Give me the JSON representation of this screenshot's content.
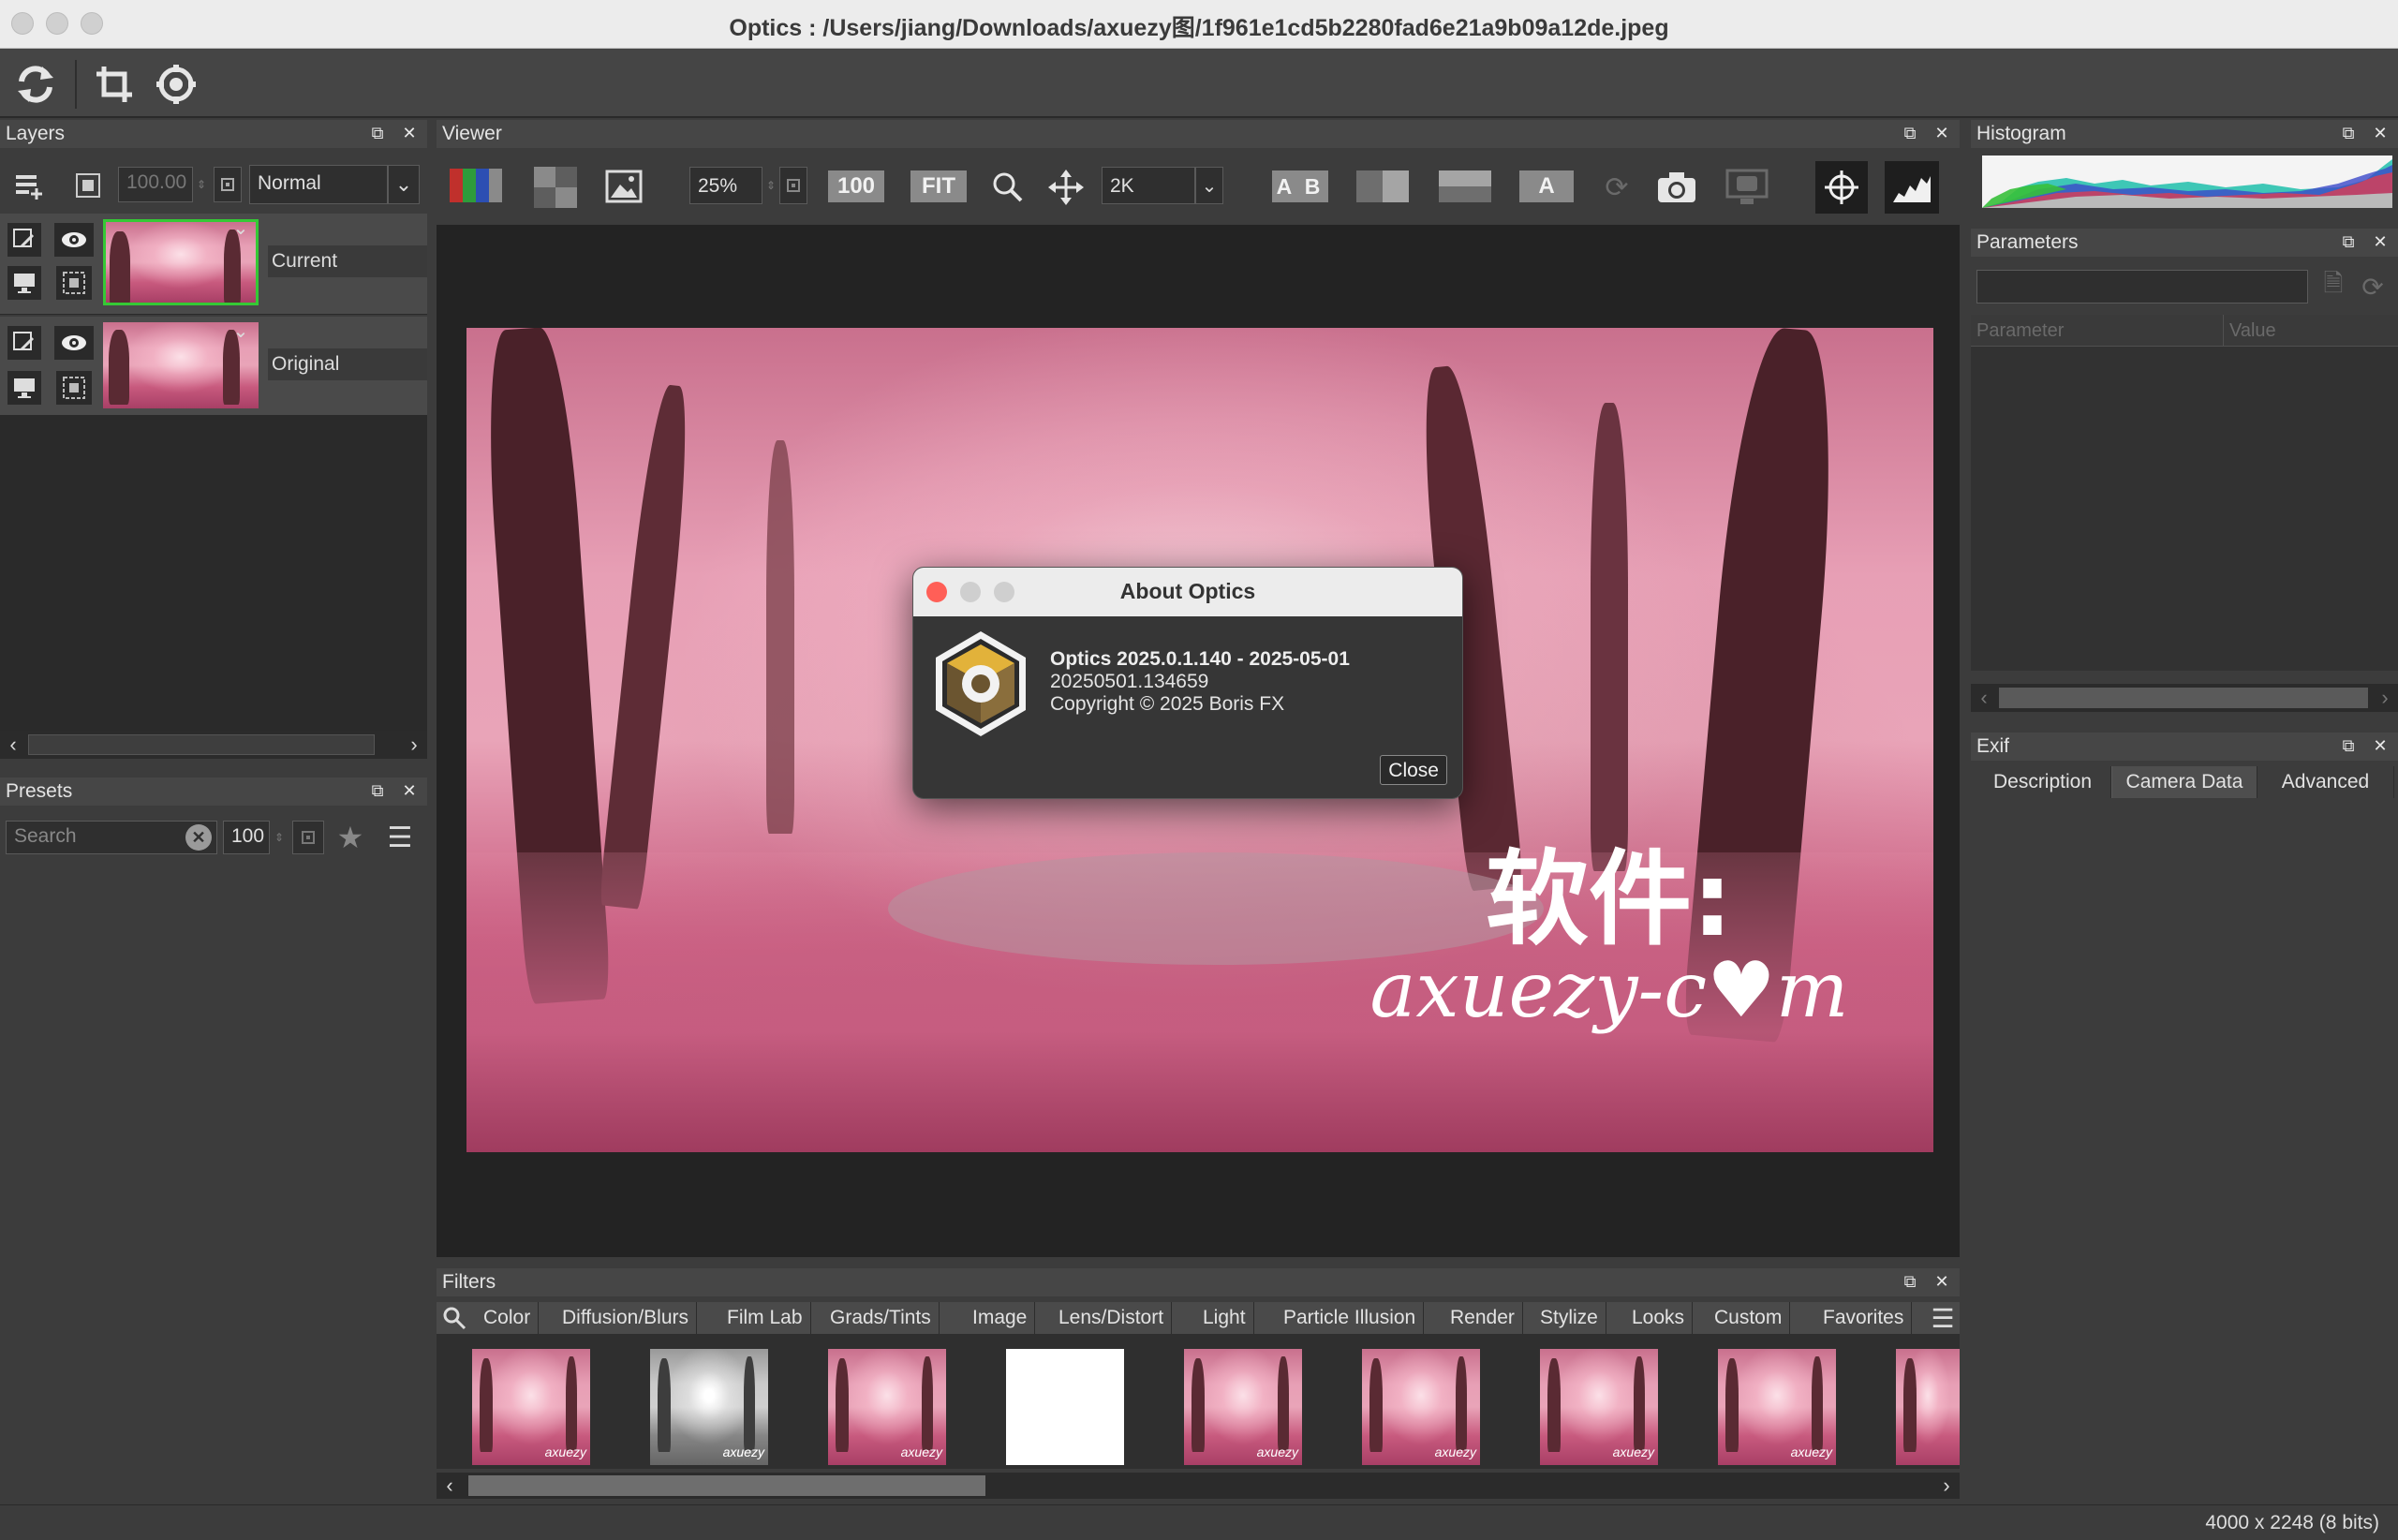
{
  "window": {
    "title": "Optics : /Users/jiang/Downloads/axuezy图/1f961e1cd5b2280fad6e21a9b09a12de.jpeg"
  },
  "toolbar": {
    "icons": [
      "refresh-icon",
      "crop-icon",
      "focus-icon"
    ]
  },
  "layers": {
    "title": "Layers",
    "opacity_value": "100.00",
    "blend_mode": "Normal",
    "items": [
      {
        "label": "Current",
        "selected": true
      },
      {
        "label": "Original",
        "selected": false
      }
    ]
  },
  "presets": {
    "title": "Presets",
    "search_placeholder": "Search",
    "size_value": "100"
  },
  "viewer": {
    "title": "Viewer",
    "zoom": "25%",
    "zoom_100": "100",
    "fit": "FIT",
    "resolution": "2K",
    "ab_label": "A B",
    "text_overlay": "A",
    "watermark_line1": "软件:",
    "watermark_line2": "axuezy-c♥m"
  },
  "about_dialog": {
    "title": "About Optics",
    "version_line": "Optics 2025.0.1.140 - 2025-05-01",
    "build_line": "20250501.134659",
    "copyright_line": "Copyright © 2025 Boris FX",
    "close_label": "Close"
  },
  "histogram": {
    "title": "Histogram"
  },
  "parameters": {
    "title": "Parameters",
    "col_parameter": "Parameter",
    "col_value": "Value"
  },
  "exif": {
    "title": "Exif",
    "tabs": [
      "Description",
      "Camera Data",
      "Advanced"
    ],
    "active_tab": "Camera Data"
  },
  "filters": {
    "title": "Filters",
    "tabs": [
      "Color",
      "Diffusion/Blurs",
      "Film Lab",
      "Grads/Tints",
      "Image",
      "Lens/Distort",
      "Light",
      "Particle Illusion",
      "Render",
      "Stylize",
      "Looks",
      "Custom",
      "Favorites"
    ],
    "thumb_label": "axuezy"
  },
  "status": {
    "image_info": "4000 x 2248 (8 bits)"
  },
  "colors": {
    "selection_border": "#35c935",
    "close_red": "#ff5f57",
    "dialog_titlebar": "#ececec"
  }
}
